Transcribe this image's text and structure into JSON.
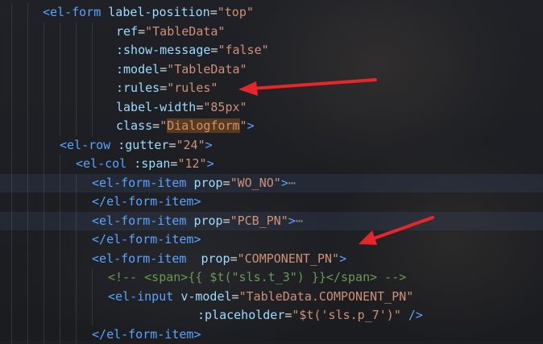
{
  "lines": [
    {
      "indent": 1,
      "tokens": [
        [
          "tag",
          "<"
        ],
        [
          "tagname",
          "el-form"
        ],
        [
          "punct",
          " "
        ],
        [
          "attr",
          "label-position"
        ],
        [
          "eq",
          "="
        ],
        [
          "str",
          "\"top\""
        ]
      ]
    },
    {
      "indent": 2,
      "tokens": [
        [
          "attr",
          "ref"
        ],
        [
          "eq",
          "="
        ],
        [
          "str",
          "\"TableData\""
        ]
      ]
    },
    {
      "indent": 2,
      "tokens": [
        [
          "attr",
          ":show-message"
        ],
        [
          "eq",
          "="
        ],
        [
          "str",
          "\"false\""
        ]
      ]
    },
    {
      "indent": 2,
      "tokens": [
        [
          "attr",
          ":model"
        ],
        [
          "eq",
          "="
        ],
        [
          "str",
          "\"TableData\""
        ]
      ]
    },
    {
      "indent": 2,
      "tokens": [
        [
          "attr",
          ":rules"
        ],
        [
          "eq",
          "="
        ],
        [
          "str",
          "\"rules\""
        ]
      ]
    },
    {
      "indent": 2,
      "tokens": [
        [
          "attr",
          "label-width"
        ],
        [
          "eq",
          "="
        ],
        [
          "str",
          "\"85px\""
        ]
      ]
    },
    {
      "indent": 2,
      "tokens": [
        [
          "attr",
          "class"
        ],
        [
          "eq",
          "="
        ],
        [
          "str",
          "\""
        ],
        [
          "strhl",
          "Dialogform"
        ],
        [
          "str",
          "\""
        ],
        [
          "tag",
          ">"
        ]
      ]
    },
    {
      "indent": 3,
      "tokens": [
        [
          "tag",
          "<"
        ],
        [
          "tagname",
          "el-row"
        ],
        [
          "punct",
          " "
        ],
        [
          "attr",
          ":gutter"
        ],
        [
          "eq",
          "="
        ],
        [
          "str",
          "\"24\""
        ],
        [
          "tag",
          ">"
        ]
      ]
    },
    {
      "indent": 4,
      "tokens": [
        [
          "tag",
          "<"
        ],
        [
          "tagname",
          "el-col"
        ],
        [
          "punct",
          " "
        ],
        [
          "attr",
          ":span"
        ],
        [
          "eq",
          "="
        ],
        [
          "str",
          "\"12\""
        ],
        [
          "tag",
          ">"
        ]
      ]
    },
    {
      "indent": 5,
      "hl": true,
      "tokens": [
        [
          "tag",
          "<"
        ],
        [
          "tagname",
          "el-form-item"
        ],
        [
          "punct",
          " "
        ],
        [
          "attr",
          "prop"
        ],
        [
          "eq",
          "="
        ],
        [
          "str",
          "\"WO_NO\""
        ],
        [
          "tag",
          ">"
        ],
        [
          "fold",
          "⋯"
        ]
      ]
    },
    {
      "indent": 5,
      "tokens": [
        [
          "tag",
          "</"
        ],
        [
          "tagname",
          "el-form-item"
        ],
        [
          "tag",
          ">"
        ]
      ]
    },
    {
      "indent": 5,
      "hl": true,
      "tokens": [
        [
          "tag",
          "<"
        ],
        [
          "tagname",
          "el-form-item"
        ],
        [
          "punct",
          " "
        ],
        [
          "attr",
          "prop"
        ],
        [
          "eq",
          "="
        ],
        [
          "str",
          "\"PCB_PN\""
        ],
        [
          "tag",
          ">"
        ],
        [
          "fold",
          "⋯"
        ]
      ]
    },
    {
      "indent": 5,
      "tokens": [
        [
          "tag",
          "</"
        ],
        [
          "tagname",
          "el-form-item"
        ],
        [
          "tag",
          ">"
        ]
      ]
    },
    {
      "indent": 5,
      "tokens": [
        [
          "tag",
          "<"
        ],
        [
          "tagname",
          "el-form-item"
        ],
        [
          "punct",
          "  "
        ],
        [
          "attr",
          "prop"
        ],
        [
          "eq",
          "="
        ],
        [
          "str",
          "\"COMPONENT_PN\""
        ],
        [
          "tag",
          ">"
        ]
      ]
    },
    {
      "indent": 6,
      "tokens": [
        [
          "comment",
          "<!-- <span>{{ $t(\"sls.t_3\") }}</span> -->"
        ]
      ]
    },
    {
      "indent": 6,
      "tokens": [
        [
          "tag",
          "<"
        ],
        [
          "tagname",
          "el-input"
        ],
        [
          "punct",
          " "
        ],
        [
          "attr",
          "v-model"
        ],
        [
          "eq",
          "="
        ],
        [
          "str",
          "\"TableData.COMPONENT_PN\""
        ]
      ]
    },
    {
      "indent": 7,
      "tokens": [
        [
          "attr",
          ":placeholder"
        ],
        [
          "eq",
          "="
        ],
        [
          "str",
          "\"$t('sls.p_7')\""
        ],
        [
          "punct",
          " "
        ],
        [
          "tag",
          "/>"
        ]
      ]
    },
    {
      "indent": 5,
      "tokens": [
        [
          "tag",
          "</"
        ],
        [
          "tagname",
          "el-form-item"
        ],
        [
          "tag",
          ">"
        ]
      ]
    }
  ],
  "colors": {
    "tag": "#59a4ff",
    "attr": "#9cdcfe",
    "string": "#ce9178",
    "comment": "#6a9955",
    "arrow": "#e8262a"
  }
}
